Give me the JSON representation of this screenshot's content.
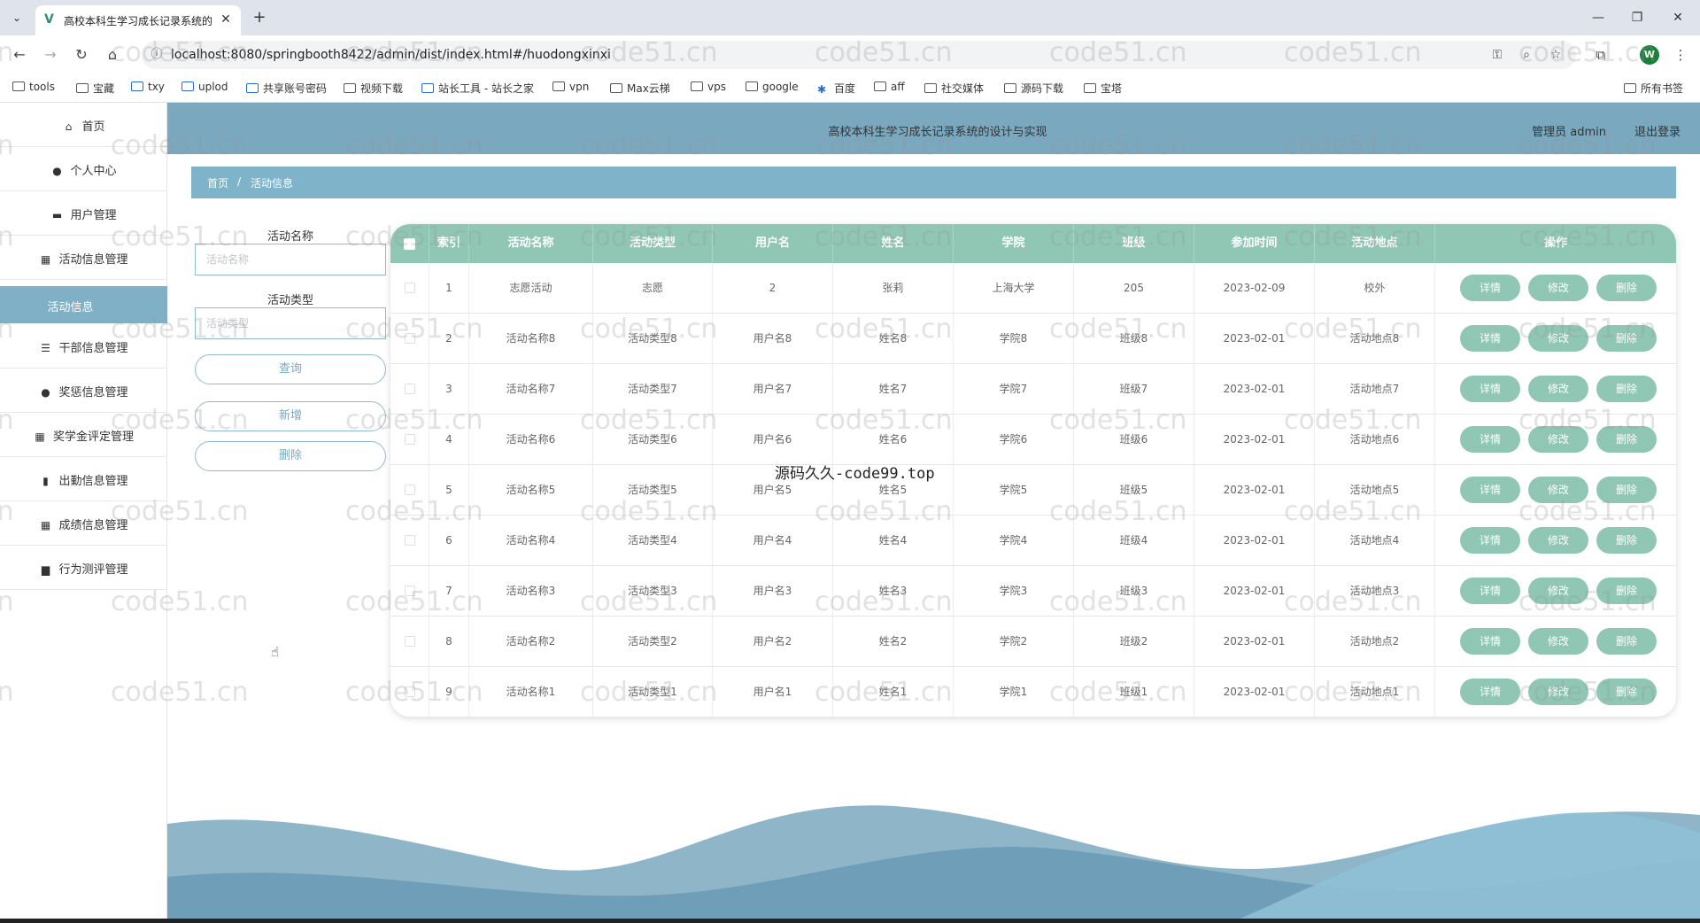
{
  "browser": {
    "tab_title": "高校本科生学习成长记录系统的",
    "url": "localhost:8080/springbooth8422/admin/dist/index.html#/huodongxinxi",
    "profile_letter": "W",
    "bookmarks": [
      "tools",
      "宝藏",
      "txy",
      "uplod",
      "共享账号密码",
      "视频下载",
      "站长工具 - 站长之家",
      "vpn",
      "Max云梯",
      "vps",
      "google",
      "百度",
      "aff",
      "社交媒体",
      "源码下载",
      "宝塔"
    ],
    "all_bookmarks": "所有书签"
  },
  "sidebar": {
    "items": [
      {
        "label": "首页",
        "icon": "home-icon"
      },
      {
        "label": "个人中心",
        "icon": "user-icon"
      },
      {
        "label": "用户管理",
        "icon": "monitor-icon"
      },
      {
        "label": "活动信息管理",
        "icon": "grid-icon"
      },
      {
        "label": "活动信息",
        "icon": ""
      },
      {
        "label": "干部信息管理",
        "icon": "list-icon"
      },
      {
        "label": "奖惩信息管理",
        "icon": "pin-icon"
      },
      {
        "label": "奖学金评定管理",
        "icon": "grid-icon"
      },
      {
        "label": "出勤信息管理",
        "icon": "bar-chart-icon"
      },
      {
        "label": "成绩信息管理",
        "icon": "grid-icon"
      },
      {
        "label": "行为测评管理",
        "icon": "book-icon"
      }
    ]
  },
  "header": {
    "title": "高校本科生学习成长记录系统的设计与实现",
    "user": "管理员 admin",
    "logout": "退出登录"
  },
  "breadcrumb": {
    "home": "首页",
    "separator": "/",
    "current": "活动信息"
  },
  "search": {
    "name_label": "活动名称",
    "name_placeholder": "活动名称",
    "type_label": "活动类型",
    "type_placeholder": "活动类型",
    "query": "查询",
    "add": "新增",
    "delete": "删除"
  },
  "table": {
    "columns": [
      "索引",
      "活动名称",
      "活动类型",
      "用户名",
      "姓名",
      "学院",
      "班级",
      "参加时间",
      "活动地点",
      "操作"
    ],
    "actions": {
      "detail": "详情",
      "edit": "修改",
      "delete": "删除"
    },
    "rows": [
      {
        "index": "1",
        "name": "志愿活动",
        "type": "志愿",
        "username": "2",
        "realname": "张莉",
        "college": "上海大学",
        "class": "205",
        "time": "2023-02-09",
        "place": "校外"
      },
      {
        "index": "2",
        "name": "活动名称8",
        "type": "活动类型8",
        "username": "用户名8",
        "realname": "姓名8",
        "college": "学院8",
        "class": "班级8",
        "time": "2023-02-01",
        "place": "活动地点8"
      },
      {
        "index": "3",
        "name": "活动名称7",
        "type": "活动类型7",
        "username": "用户名7",
        "realname": "姓名7",
        "college": "学院7",
        "class": "班级7",
        "time": "2023-02-01",
        "place": "活动地点7"
      },
      {
        "index": "4",
        "name": "活动名称6",
        "type": "活动类型6",
        "username": "用户名6",
        "realname": "姓名6",
        "college": "学院6",
        "class": "班级6",
        "time": "2023-02-01",
        "place": "活动地点6"
      },
      {
        "index": "5",
        "name": "活动名称5",
        "type": "活动类型5",
        "username": "用户名5",
        "realname": "姓名5",
        "college": "学院5",
        "class": "班级5",
        "time": "2023-02-01",
        "place": "活动地点5"
      },
      {
        "index": "6",
        "name": "活动名称4",
        "type": "活动类型4",
        "username": "用户名4",
        "realname": "姓名4",
        "college": "学院4",
        "class": "班级4",
        "time": "2023-02-01",
        "place": "活动地点4"
      },
      {
        "index": "7",
        "name": "活动名称3",
        "type": "活动类型3",
        "username": "用户名3",
        "realname": "姓名3",
        "college": "学院3",
        "class": "班级3",
        "time": "2023-02-01",
        "place": "活动地点3"
      },
      {
        "index": "8",
        "name": "活动名称2",
        "type": "活动类型2",
        "username": "用户名2",
        "realname": "姓名2",
        "college": "学院2",
        "class": "班级2",
        "time": "2023-02-01",
        "place": "活动地点2"
      },
      {
        "index": "9",
        "name": "活动名称1",
        "type": "活动类型1",
        "username": "用户名1",
        "realname": "姓名1",
        "college": "学院1",
        "class": "班级1",
        "time": "2023-02-01",
        "place": "活动地点1"
      }
    ]
  },
  "watermark": {
    "text": "code51.cn",
    "center_text": "源码久久-code99.top"
  },
  "colors": {
    "header": "#7aa8be",
    "table_head": "#8fc7b4",
    "active_menu": "#7fb0c6"
  }
}
